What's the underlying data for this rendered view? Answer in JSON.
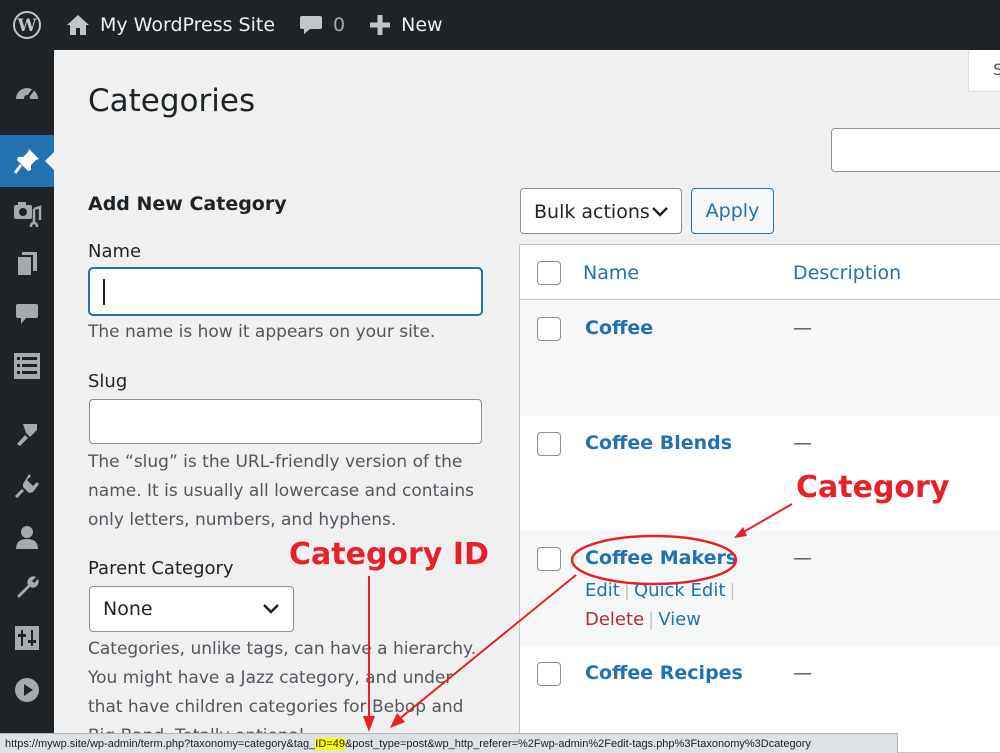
{
  "adminbar": {
    "site_name": "My WordPress Site",
    "comments_count": "0",
    "new_label": "New"
  },
  "screen_options": {
    "label": "S"
  },
  "page": {
    "title": "Categories"
  },
  "form": {
    "title": "Add New Category",
    "name_label": "Name",
    "name_value": "",
    "name_help": "The name is how it appears on your site.",
    "slug_label": "Slug",
    "slug_value": "",
    "slug_help": "The “slug” is the URL-friendly version of the name. It is usually all lowercase and contains only letters, numbers, and hyphens.",
    "parent_label": "Parent Category",
    "parent_value": "None",
    "parent_help": "Categories, unlike tags, can have a hierarchy. You might have a Jazz category, and under that have children categories for Bebop and Big Band. Totally optional."
  },
  "bulk": {
    "select_label": "Bulk actions",
    "apply_label": "Apply"
  },
  "table": {
    "columns": [
      "Name",
      "Description"
    ],
    "rows": [
      {
        "name": "Coffee",
        "description": "—"
      },
      {
        "name": "Coffee Blends",
        "description": "—"
      },
      {
        "name": "Coffee Makers",
        "description": "—"
      },
      {
        "name": "Coffee Recipes",
        "description": "—"
      }
    ],
    "row_actions": {
      "edit": "Edit",
      "quick_edit": "Quick Edit",
      "delete": "Delete",
      "view": "View"
    }
  },
  "statusbar": {
    "url_before": "https://mywp.site/wp-admin/term.php?taxonomy=category&tag_",
    "url_highlight": "ID=49",
    "url_after": "&post_type=post&wp_http_referer=%2Fwp-admin%2Fedit-tags.php%3Ftaxonomy%3Dcategory"
  },
  "annotations": {
    "category_label": "Category",
    "category_id_label": "Category ID",
    "color": "#e8202a"
  },
  "colors": {
    "admin_bar": "#1d2327",
    "link": "#2271b1",
    "delete": "#b32d2e",
    "highlight": "#ffff00"
  },
  "menu_icons": [
    "dashboard-icon",
    "posts-pin-icon",
    "media-icon",
    "pages-icon",
    "comments-icon",
    "forms-icon",
    "appearance-icon",
    "plugins-icon",
    "users-icon",
    "tools-icon",
    "settings-icon",
    "play-icon"
  ]
}
